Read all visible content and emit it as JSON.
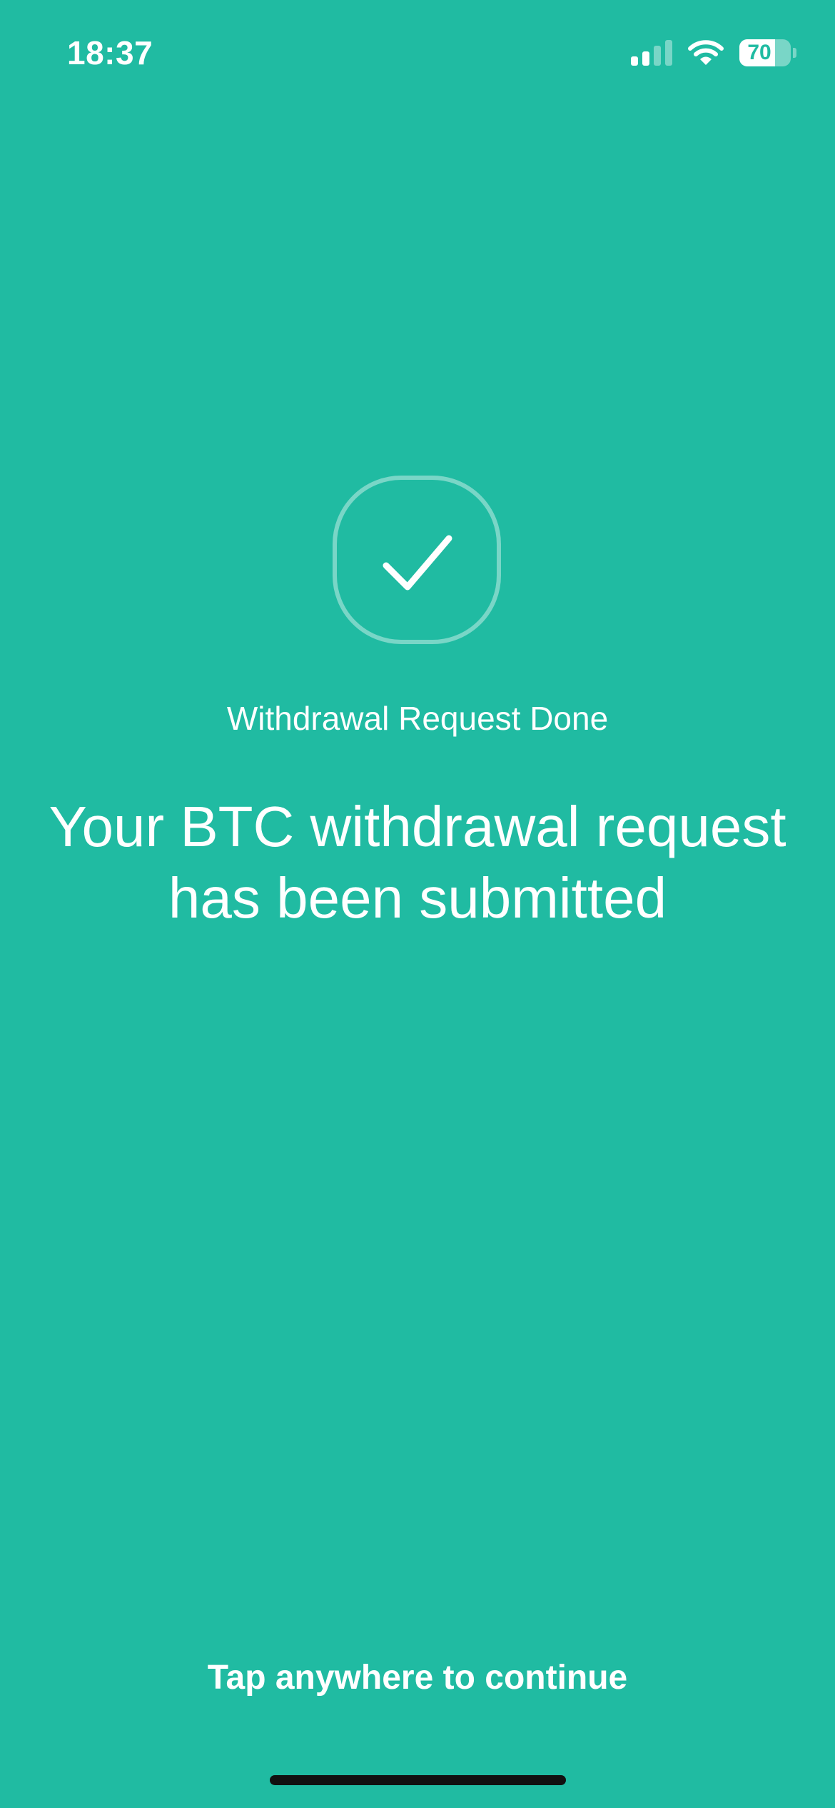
{
  "status_bar": {
    "time": "18:37",
    "battery_level": "70",
    "battery_fraction": 0.7,
    "signal_bars_active": 2,
    "signal_bars_total": 4
  },
  "success": {
    "icon": "checkmark-icon",
    "label": "Withdrawal Request Done",
    "message": "Your BTC withdrawal request has been submitted"
  },
  "footer": {
    "hint": "Tap anywhere to continue"
  },
  "colors": {
    "background": "#20bba2",
    "foreground": "#ffffff",
    "home_indicator": "#111111"
  }
}
